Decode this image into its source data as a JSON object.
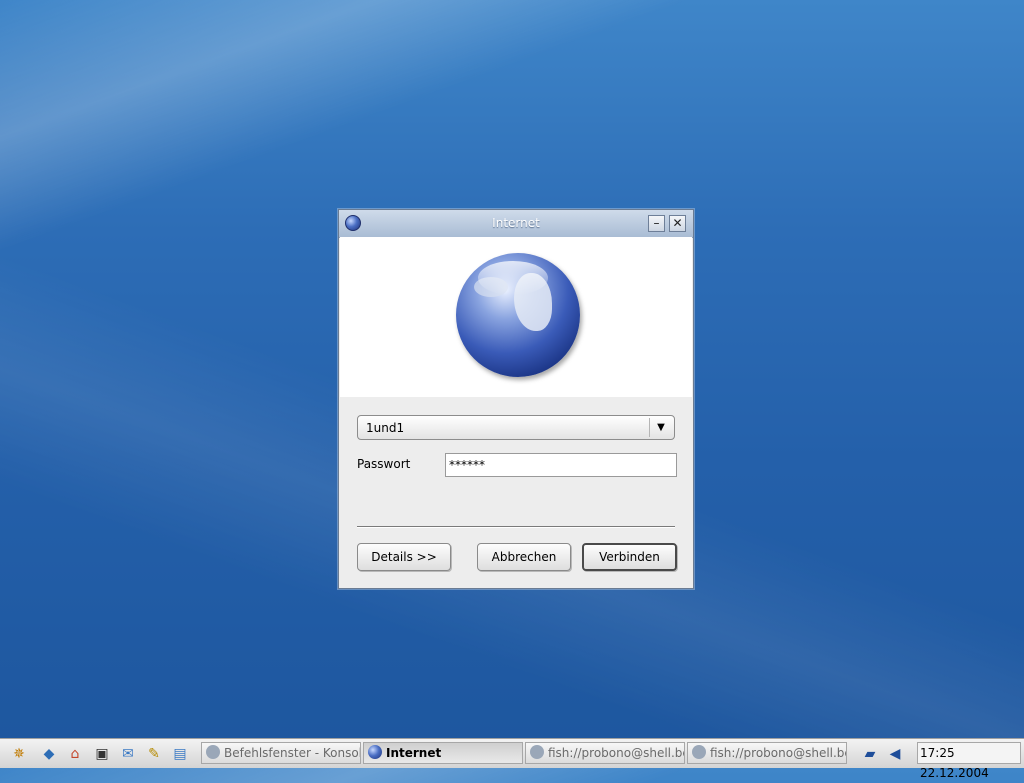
{
  "window": {
    "title": "Internet"
  },
  "connection": {
    "selected": "1und1"
  },
  "password": {
    "label": "Passwort",
    "value": "******"
  },
  "buttons": {
    "details": "Details >>",
    "cancel": "Abbrechen",
    "connect": "Verbinden"
  },
  "taskbar": {
    "tasks": [
      {
        "label": "Befehlsfenster - Konsole"
      },
      {
        "label": "Internet"
      },
      {
        "label": "fish://probono@shell.be"
      },
      {
        "label": "fish://probono@shell.be"
      }
    ],
    "time": "17:25",
    "date": "22.12.2004"
  },
  "icons": {
    "title_icon": "globe-icon",
    "minimize": "minimize-icon",
    "close": "close-icon",
    "combo_arrow": "chevron-down-icon"
  },
  "colors": {
    "desktop": "#2d6db6",
    "titlebar": "#a9bcd4",
    "dialog": "#ededed"
  }
}
